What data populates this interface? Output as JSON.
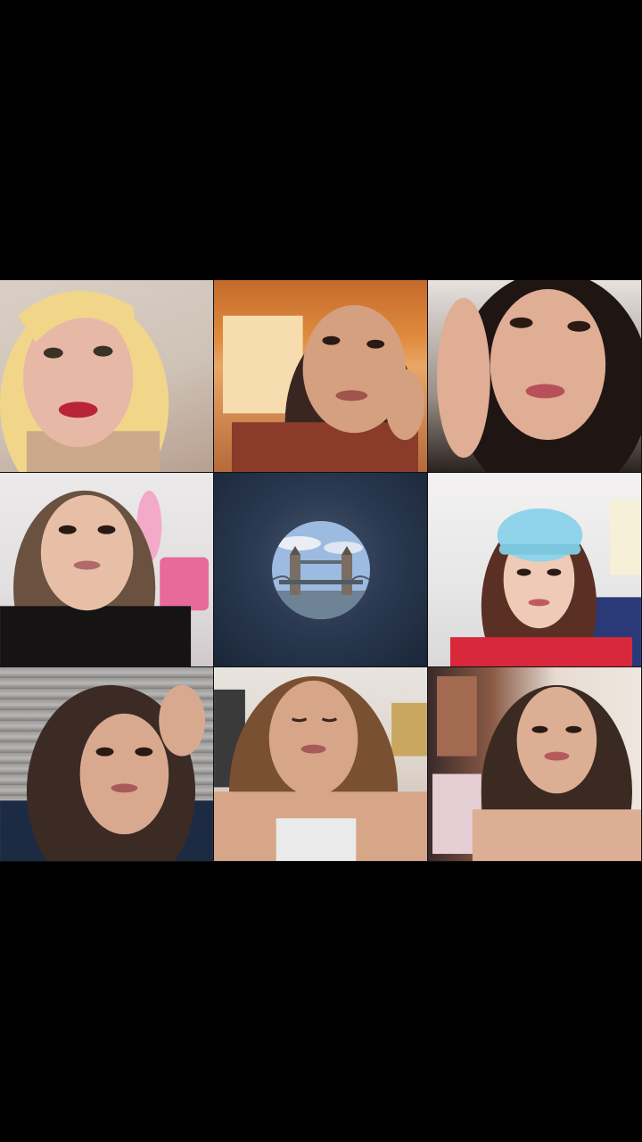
{
  "call": {
    "participants": [
      {
        "id": "p1",
        "name": "",
        "skin": "#e8b8a6",
        "hair": "#f1d68a"
      },
      {
        "id": "p2",
        "name": "",
        "skin": "#d5a07f",
        "hair": "#3a2620"
      },
      {
        "id": "p3",
        "name": "",
        "skin": "#e0ad95",
        "hair": "#1f1614"
      },
      {
        "id": "p4",
        "name": "",
        "skin": "#e7bfa7",
        "hair": "#6a5140"
      },
      {
        "id": "p5",
        "name": "",
        "avatar": "tower-bridge-avatar"
      },
      {
        "id": "p6",
        "name": "",
        "skin": "#efcbb7",
        "hair": "#5a3024",
        "hat": "#8fd4ea",
        "shirt": "#d8283b"
      },
      {
        "id": "p7",
        "name": "",
        "skin": "#d9a98f",
        "hair": "#3b2b24"
      },
      {
        "id": "p8",
        "name": "",
        "skin": "#d7a688",
        "hair": "#7a5032"
      },
      {
        "id": "p9",
        "name": "",
        "skin": "#dcae93",
        "hair": "#3a2a22"
      }
    ]
  },
  "colors": {
    "background": "#000000",
    "avatar_tile": "#2b3a52"
  }
}
